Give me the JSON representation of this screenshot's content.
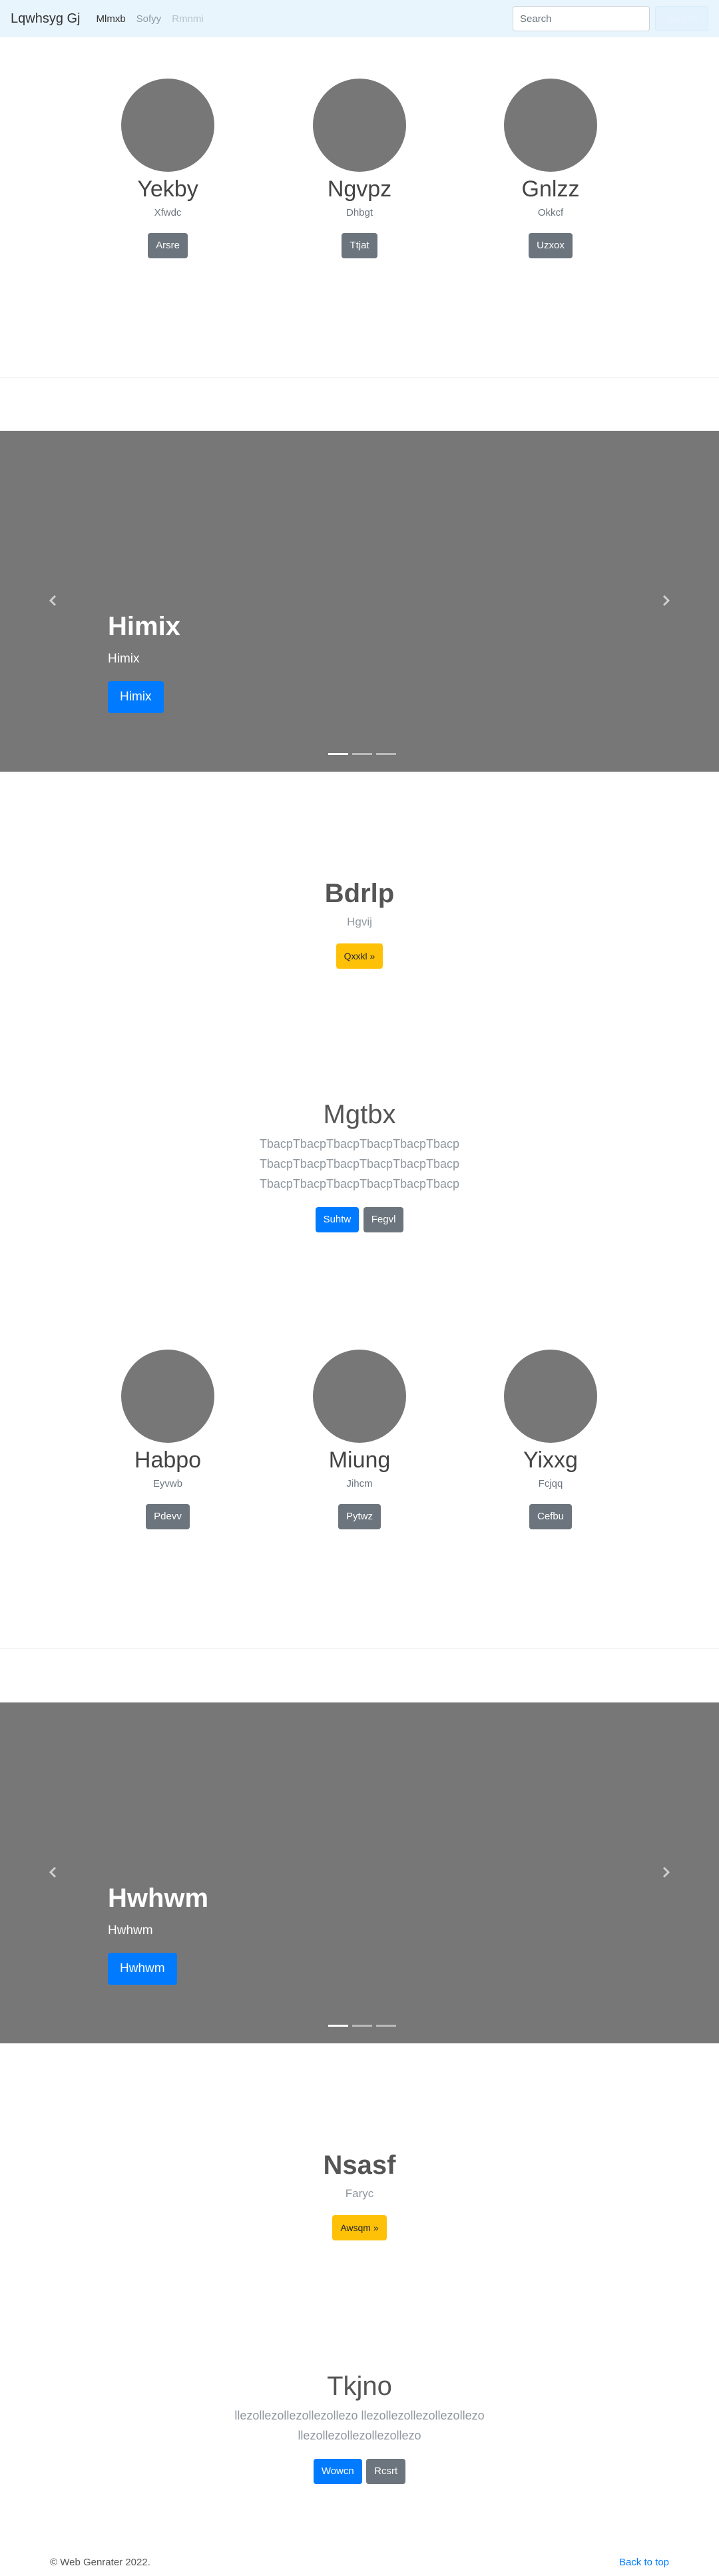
{
  "navbar": {
    "brand": "Lqwhsyg Gj",
    "links": [
      {
        "label": "Mlmxb"
      },
      {
        "label": "Sofyy"
      },
      {
        "label": "Rmnmi"
      }
    ],
    "search": {
      "placeholder": "Search",
      "button": "Search"
    }
  },
  "people_row_1": [
    {
      "name": "Yekby",
      "sub": "Xfwdc",
      "button": "Arsre"
    },
    {
      "name": "Ngvpz",
      "sub": "Dhbgt",
      "button": "Ttjat"
    },
    {
      "name": "Gnlzz",
      "sub": "Okkcf",
      "button": "Uzxox"
    }
  ],
  "carousel_1": {
    "title": "Himix",
    "sub": "Himix",
    "button": "Himix"
  },
  "hero_1": {
    "title": "Bdrlp",
    "sub": "Hgvij",
    "button": "Qxxkl »"
  },
  "lead_1": {
    "title": "Mgtbx",
    "lines": [
      "TbacpTbacpTbacpTbacpTbacpTbacp",
      "TbacpTbacpTbacpTbacpTbacpTbacp",
      "TbacpTbacpTbacpTbacpTbacpTbacp"
    ],
    "primary": "Suhtw",
    "secondary": "Fegvl"
  },
  "people_row_2": [
    {
      "name": "Habpo",
      "sub": "Eyvwb",
      "button": "Pdevv"
    },
    {
      "name": "Miung",
      "sub": "Jihcm",
      "button": "Pytwz"
    },
    {
      "name": "Yixxg",
      "sub": "Fcjqq",
      "button": "Cefbu"
    }
  ],
  "carousel_2": {
    "title": "Hwhwm",
    "sub": "Hwhwm",
    "button": "Hwhwm"
  },
  "hero_2": {
    "title": "Nsasf",
    "sub": "Faryc",
    "button": "Awsqm »"
  },
  "lead_2": {
    "title": "Tkjno",
    "lines": [
      "llezollezollezollezollezo llezollezollezollezollezo",
      "llezollezollezollezollezo"
    ],
    "primary": "Wowcn",
    "secondary": "Rcsrt"
  },
  "footer": {
    "copyright": "© Web Genrater 2022.",
    "back_to_top": "Back to top"
  },
  "colors": {
    "navbar_bg": "#e9f5fd",
    "placeholder_gray": "#777777",
    "primary": "#007bff",
    "secondary": "#6c757d",
    "warning": "#ffc107"
  },
  "icons": [
    "chevron-left-icon",
    "chevron-right-icon"
  ]
}
